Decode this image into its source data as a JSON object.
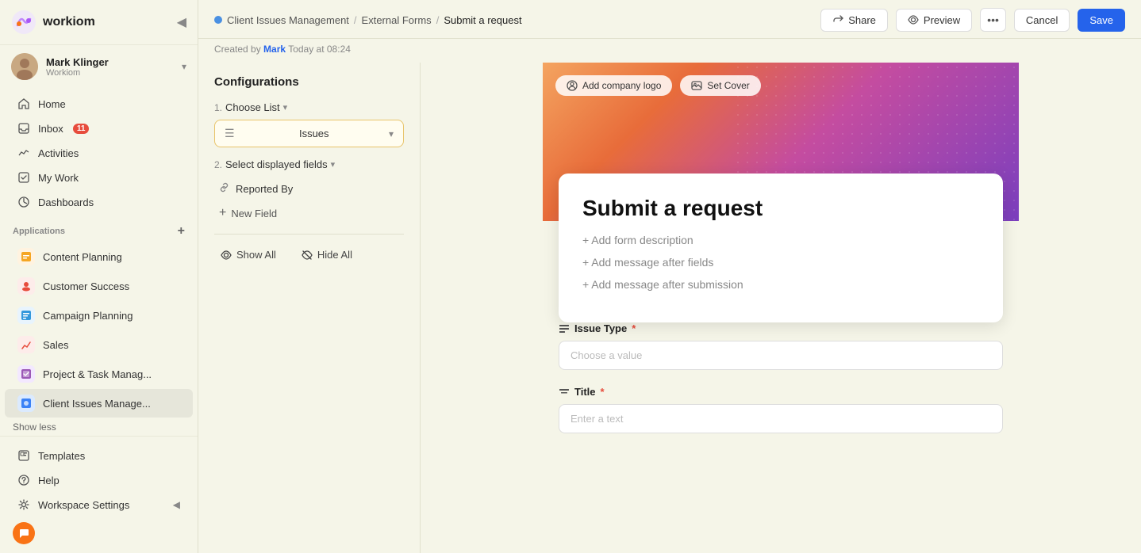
{
  "sidebar": {
    "logo": "workiom",
    "user": {
      "name": "Mark Klinger",
      "org": "Workiom"
    },
    "nav": [
      {
        "id": "home",
        "label": "Home",
        "icon": "home"
      },
      {
        "id": "inbox",
        "label": "Inbox",
        "badge": "11",
        "icon": "inbox"
      },
      {
        "id": "activities",
        "label": "Activities",
        "icon": "activities"
      },
      {
        "id": "mywork",
        "label": "My Work",
        "icon": "mywork"
      },
      {
        "id": "dashboards",
        "label": "Dashboards",
        "icon": "dashboards"
      }
    ],
    "applications_label": "Applications",
    "apps": [
      {
        "id": "content-planning",
        "label": "Content Planning",
        "color": "#f5a623"
      },
      {
        "id": "customer-success",
        "label": "Customer Success",
        "color": "#e74c3c"
      },
      {
        "id": "campaign-planning",
        "label": "Campaign Planning",
        "color": "#3498db"
      },
      {
        "id": "sales",
        "label": "Sales",
        "color": "#e74c3c"
      },
      {
        "id": "project-task",
        "label": "Project & Task Manag...",
        "color": "#9b59b6"
      },
      {
        "id": "client-issues",
        "label": "Client Issues Manage...",
        "color": "#3b82f6",
        "active": true
      }
    ],
    "show_less": "Show less",
    "bottom_nav": [
      {
        "id": "templates",
        "label": "Templates",
        "icon": "templates"
      },
      {
        "id": "help",
        "label": "Help",
        "icon": "help"
      },
      {
        "id": "workspace-settings",
        "label": "Workspace Settings",
        "icon": "settings"
      }
    ]
  },
  "breadcrumb": {
    "dot_color": "#4a90e2",
    "items": [
      {
        "label": "Client Issues Management",
        "active": false
      },
      {
        "label": "External Forms",
        "active": false
      },
      {
        "label": "Submit a request",
        "active": true
      }
    ]
  },
  "creator_info": {
    "prefix": "Created by",
    "author": "Mark",
    "suffix": "Today at 08:24"
  },
  "toolbar": {
    "share_label": "Share",
    "preview_label": "Preview",
    "cancel_label": "Cancel",
    "save_label": "Save"
  },
  "config": {
    "title": "Configurations",
    "step1": {
      "label": "Choose List",
      "selected_value": "Issues"
    },
    "step2": {
      "label": "Select displayed fields",
      "fields": [
        {
          "label": "Reported By"
        }
      ],
      "add_field_label": "New Field"
    },
    "show_all_label": "Show All",
    "hide_all_label": "Hide All"
  },
  "form_preview": {
    "cover_btn1": "Add company logo",
    "cover_btn2": "Set Cover",
    "title": "Submit a request",
    "add_description": "+ Add form description",
    "add_message_after_fields": "+ Add message after fields",
    "add_message_after_submission": "+ Add message after submission",
    "fields": [
      {
        "label": "Issue Type",
        "required": true,
        "placeholder": "Choose a value",
        "type": "select"
      },
      {
        "label": "Title",
        "required": true,
        "placeholder": "Enter a text",
        "type": "text"
      }
    ]
  }
}
